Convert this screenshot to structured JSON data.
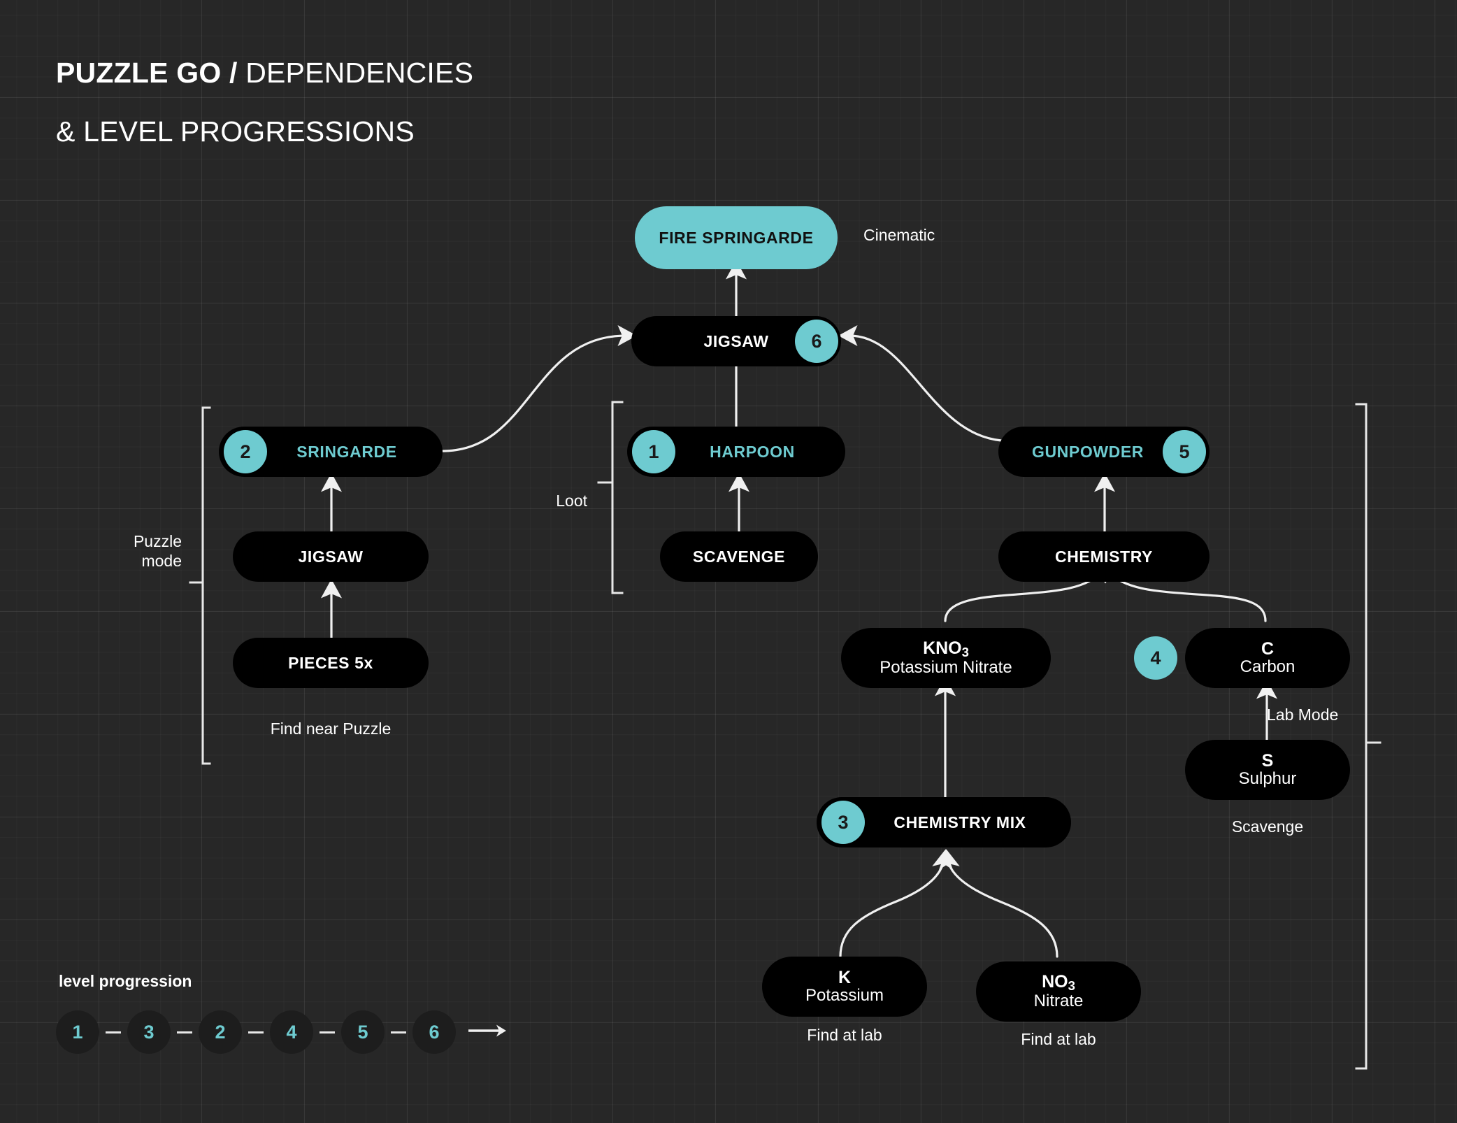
{
  "title": {
    "brand": "PUZZLE GO",
    "separator": " / ",
    "part1": "DEPENDENCIES",
    "line2": "& LEVEL PROGRESSIONS"
  },
  "theme": {
    "background": "#272727",
    "node_fill": "#000000",
    "accent": "#6ecbd0",
    "text": "#ffffff",
    "grid_line": "#3a3a3a",
    "edge_line": "#f0f0f0"
  },
  "nodes": {
    "fire_springarde": {
      "label": "FIRE SPRINGARDE",
      "style": "teal-fill"
    },
    "jigsaw_top": {
      "label": "JIGSAW",
      "badge": "6",
      "badge_side": "right"
    },
    "sringarde": {
      "label": "SRINGARDE",
      "badge": "2",
      "badge_side": "left",
      "style": "teal-text"
    },
    "jigsaw_left": {
      "label": "JIGSAW"
    },
    "pieces": {
      "label": "PIECES 5x"
    },
    "harpoon": {
      "label": "HARPOON",
      "badge": "1",
      "badge_side": "left",
      "style": "teal-text"
    },
    "scavenge": {
      "label": "SCAVENGE"
    },
    "gunpowder": {
      "label": "GUNPOWDER",
      "badge": "5",
      "badge_side": "right",
      "style": "teal-text"
    },
    "chemistry": {
      "label": "CHEMISTRY"
    },
    "kno3": {
      "symbol": "KNO",
      "symbol_sub": "3",
      "sub_label": "Potassium Nitrate"
    },
    "carbon": {
      "symbol": "C",
      "sub_label": "Carbon",
      "badge": "4",
      "badge_side": "left"
    },
    "sulphur": {
      "symbol": "S",
      "sub_label": "Sulphur"
    },
    "chemistry_mix": {
      "label": "CHEMISTRY MIX",
      "badge": "3",
      "badge_side": "left"
    },
    "potassium": {
      "symbol": "K",
      "sub_label": "Potassium"
    },
    "nitrate": {
      "symbol": "NO",
      "symbol_sub": "3",
      "sub_label": "Nitrate"
    }
  },
  "annotations": {
    "cinematic": "Cinematic",
    "puzzle_mode": "Puzzle\nmode",
    "loot": "Loot",
    "find_near_puzzle": "Find near Puzzle",
    "lab_mode": "Lab Mode",
    "scavenge_note": "Scavenge",
    "find_at_lab_k": "Find at lab",
    "find_at_lab_no3": "Find at lab"
  },
  "legend": {
    "title": "level progression",
    "steps": [
      "1",
      "3",
      "2",
      "4",
      "5",
      "6"
    ]
  }
}
